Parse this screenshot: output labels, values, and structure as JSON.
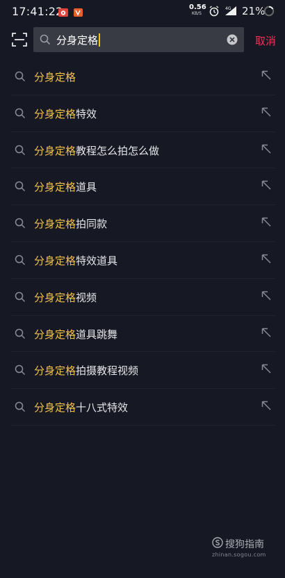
{
  "status_bar": {
    "time": "17:41:22",
    "net_speed_value": "0.56",
    "net_speed_unit": "KB/S",
    "network_type": "4G",
    "battery_percent": "21%"
  },
  "search": {
    "query": "分身定格",
    "cancel_label": "取消"
  },
  "suggestions": [
    {
      "highlight": "分身定格",
      "rest": ""
    },
    {
      "highlight": "分身定格",
      "rest": "特效"
    },
    {
      "highlight": "分身定格",
      "rest": "教程怎么拍怎么做"
    },
    {
      "highlight": "分身定格",
      "rest": "道具"
    },
    {
      "highlight": "分身定格",
      "rest": "拍同款"
    },
    {
      "highlight": "分身定格",
      "rest": "特效道具"
    },
    {
      "highlight": "分身定格",
      "rest": "视频"
    },
    {
      "highlight": "分身定格",
      "rest": "道具跳舞"
    },
    {
      "highlight": "分身定格",
      "rest": "拍摄教程视频"
    },
    {
      "highlight": "分身定格",
      "rest": "十八式特效"
    }
  ],
  "watermark": {
    "brand": "搜狗指南",
    "url": "zhinan.sogou.com"
  },
  "colors": {
    "background": "#161823",
    "highlight": "#f2c14c",
    "cancel": "#fe2c55",
    "caret": "#f7c31a"
  }
}
